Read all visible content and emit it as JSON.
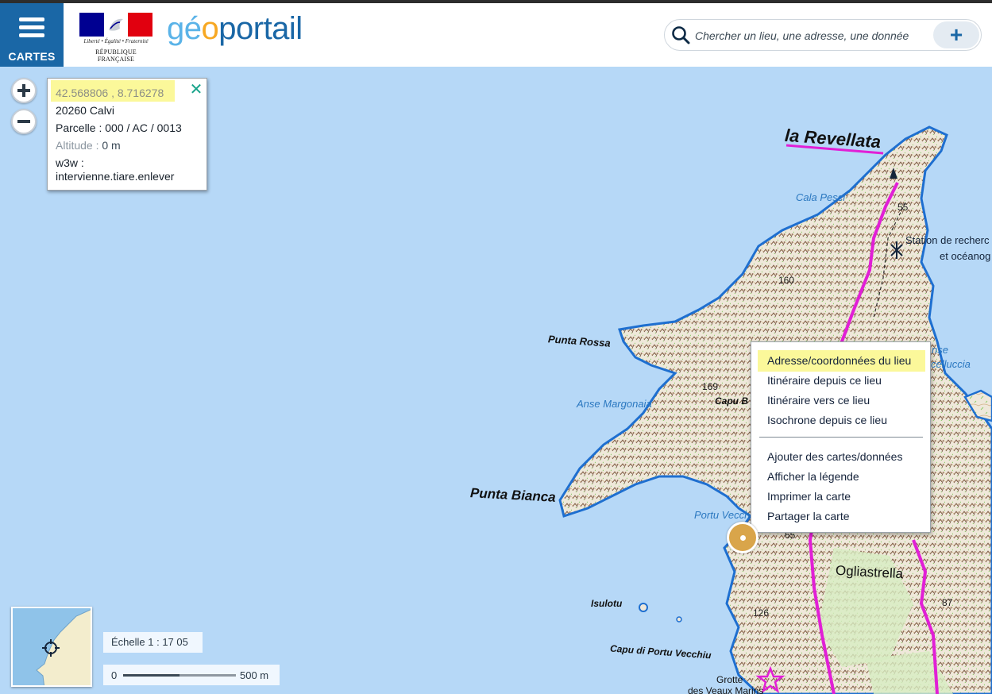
{
  "header": {
    "menu_label": "CARTES",
    "rf_logo": {
      "motto": "Liberté • Égalité • Fraternité",
      "name": "RÉPUBLIQUE FRANÇAISE",
      "colors": [
        "#000091",
        "#ffffff",
        "#e1000f"
      ]
    },
    "brand": {
      "part1": "gé",
      "part2": "o",
      "part3": "portail"
    },
    "search": {
      "placeholder": "Chercher un lieu, une adresse, une donnée",
      "add_label": "+"
    }
  },
  "map_labels": {
    "revellata": "la Revellata",
    "cala_pesci": "Cala Pesci",
    "station_line1": "Station de recherc",
    "station_line2": "et océanog",
    "punta_rossa": "Punta Rossa",
    "anse_marg": "Anse Margonaia",
    "capu_b": "Capu B",
    "punta_bianca": "Punta Bianca",
    "portu_vecch": "Portu Vecch",
    "ogliastrella": "Ogliastrella",
    "isulotu": "Isulotu",
    "capu_portu": "Capu di Portu Vecchiu",
    "grotte1": "Grotte",
    "grotte2": "des Veaux Marins",
    "anse_r1": "nse",
    "anse_r2": "celluccia",
    "alt_55": "55",
    "alt_160": "160",
    "alt_169": "169",
    "alt_65": "65",
    "alt_126": "126",
    "alt_87": "87"
  },
  "info_popup": {
    "coords": "42.568806 , 8.716278",
    "close": "✕",
    "address": "20260 Calvi",
    "parcel": "Parcelle : 000 / AC / 0013",
    "altitude_label": "Altitude : ",
    "altitude_value": "0 m",
    "w3w_label": "w3w :",
    "w3w_value": "intervienne.tiare.enlever"
  },
  "context_menu": {
    "items_top": [
      "Adresse/coordonnées du lieu",
      "Itinéraire depuis ce lieu",
      "Itinéraire vers ce lieu",
      "Isochrone depuis ce lieu"
    ],
    "items_bottom": [
      "Ajouter des cartes/données",
      "Afficher la légende",
      "Imprimer la carte",
      "Partager la carte"
    ]
  },
  "scale": {
    "text": "Échelle 1 : 17 05",
    "zero": "0",
    "distance": "500 m"
  },
  "colors": {
    "menu_blue": "#1a67a6",
    "highlight": "#fbf89a",
    "sea": "#b6d8f7",
    "land": "#f2ede2",
    "trail": "#e11fd6"
  }
}
